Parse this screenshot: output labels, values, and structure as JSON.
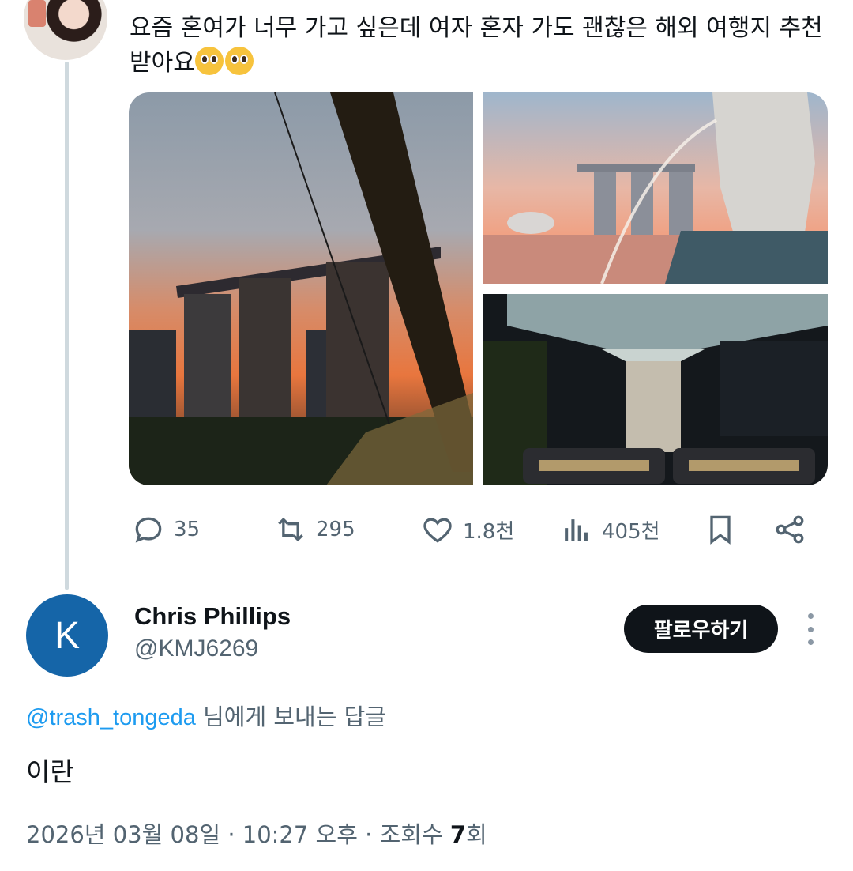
{
  "tweet": {
    "text": "요즘 혼여가 너무 가고 싶은데 여자 혼자 가도 괜찮은 해외 여행지 추천",
    "text_line2": "받아요",
    "emoji_icons": [
      "pleading-face-icon",
      "pleading-face-icon"
    ],
    "media": [
      {
        "name": "marina-bay-sands-sunset-photo"
      },
      {
        "name": "merlion-park-photo"
      },
      {
        "name": "jewel-rain-vortex-photo"
      }
    ],
    "actions": {
      "reply_count": "35",
      "retweet_count": "295",
      "like_count": "1.8천",
      "views_count": "405천"
    }
  },
  "reply": {
    "avatar_letter": "K",
    "avatar_color": "#1565a8",
    "display_name": "Chris Phillips",
    "handle": "@KMJ6269",
    "follow_label": "팔로우하기",
    "replying_to_handle": "@trash_tongeda",
    "replying_to_suffix": "님에게 보내는 답글",
    "body": "이란",
    "date": "2026년 03월 08일",
    "time": "10:27 오후",
    "views_label": "조회수",
    "views_count": "7",
    "views_unit": "회"
  },
  "colors": {
    "link": "#1d9bf0",
    "secondary_text": "#536471",
    "follow_button": "#0f1419"
  }
}
